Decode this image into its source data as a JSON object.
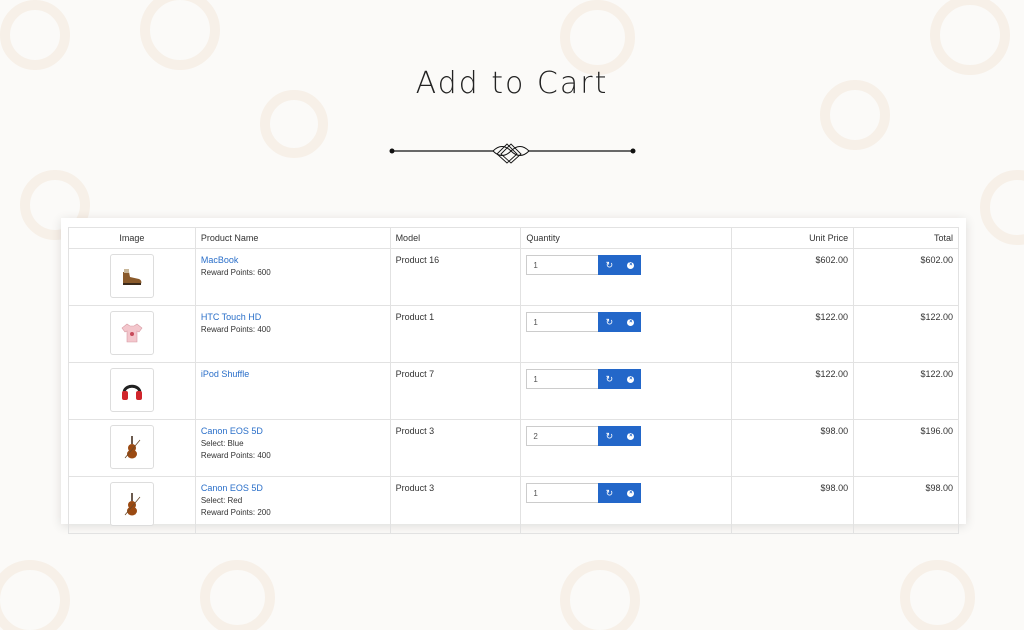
{
  "page": {
    "title": "Add to Cart"
  },
  "table": {
    "headers": {
      "image": "Image",
      "product_name": "Product Name",
      "model": "Model",
      "quantity": "Quantity",
      "unit_price": "Unit Price",
      "total": "Total"
    },
    "rows": [
      {
        "thumb_icon": "shoe-icon",
        "name": "MacBook",
        "options": [
          "Reward Points: 600"
        ],
        "model": "Product 16",
        "qty": "1",
        "unit_price": "$602.00",
        "total": "$602.00"
      },
      {
        "thumb_icon": "tshirt-icon",
        "name": "HTC Touch HD",
        "options": [
          "Reward Points: 400"
        ],
        "model": "Product 1",
        "qty": "1",
        "unit_price": "$122.00",
        "total": "$122.00"
      },
      {
        "thumb_icon": "headphones-icon",
        "name": "iPod Shuffle",
        "options": [],
        "model": "Product 7",
        "qty": "1",
        "unit_price": "$122.00",
        "total": "$122.00"
      },
      {
        "thumb_icon": "violin-icon",
        "name": "Canon EOS 5D",
        "options": [
          "Select: Blue",
          "Reward Points: 400"
        ],
        "model": "Product 3",
        "qty": "2",
        "unit_price": "$98.00",
        "total": "$196.00"
      },
      {
        "thumb_icon": "violin-icon",
        "name": "Canon EOS 5D",
        "options": [
          "Select: Red",
          "Reward Points: 200"
        ],
        "model": "Product 3",
        "qty": "1",
        "unit_price": "$98.00",
        "total": "$98.00"
      }
    ]
  },
  "icons": {
    "update": "refresh-icon",
    "remove": "remove-icon"
  },
  "colors": {
    "link": "#2a6fc9",
    "button": "#2367c9"
  }
}
